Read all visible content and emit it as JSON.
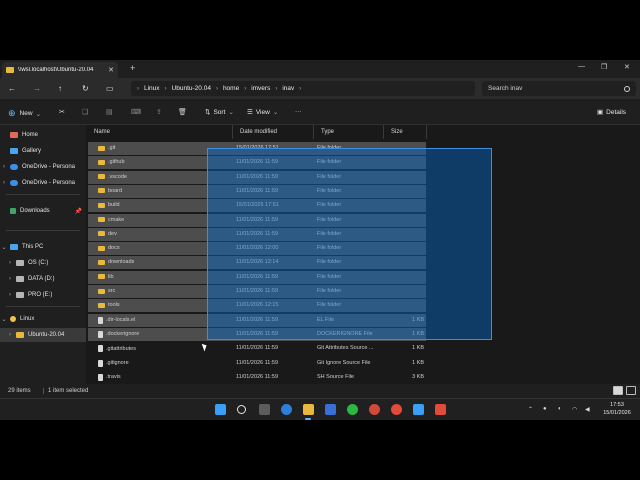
{
  "window": {
    "tab_title": "\\\\wsl.localhost\\Ubuntu-20.04",
    "tab_close": "✕",
    "tab_add": "+"
  },
  "address": {
    "crumbs": [
      "Linux",
      "Ubuntu-20.04",
      "home",
      "imvers",
      "inav"
    ],
    "search_placeholder": "Search inav"
  },
  "toolbar": {
    "new_label": "New",
    "sort_label": "Sort",
    "view_label": "View",
    "more_label": "···",
    "details_label": "Details"
  },
  "sidebar": {
    "items": [
      {
        "label": "Home",
        "color": "#e36a5a"
      },
      {
        "label": "Gallery",
        "color": "#4aa3f0"
      },
      {
        "label": "OneDrive - Persona",
        "color": "#3b8fe8"
      },
      {
        "label": "OneDrive - Persona",
        "color": "#3b8fe8"
      },
      {
        "label": "Downloads",
        "color": "#3fa36a"
      },
      {
        "label": "This PC",
        "color": "#4aa3f0"
      },
      {
        "label": "OS (C:)",
        "color": "#b5b5b5"
      },
      {
        "label": "DATA (D:)",
        "color": "#b5b5b5"
      },
      {
        "label": "PRO (E:)",
        "color": "#b5b5b5"
      },
      {
        "label": "Linux",
        "color": "#f0c24a"
      },
      {
        "label": "Ubuntu-20.04",
        "color": "#e8b93d"
      }
    ]
  },
  "columns": {
    "name": "Name",
    "date": "Date modified",
    "type": "Type",
    "size": "Size"
  },
  "files": [
    {
      "name": ".git",
      "date": "15/01/2026 17:51",
      "type": "File folder",
      "size": "",
      "kind": "folder",
      "selected": true
    },
    {
      "name": ".github",
      "date": "11/01/2026 11:59",
      "type": "File folder",
      "size": "",
      "kind": "folder",
      "selected": true
    },
    {
      "name": ".vscode",
      "date": "11/01/2026 11:59",
      "type": "File folder",
      "size": "",
      "kind": "folder",
      "selected": true
    },
    {
      "name": "board",
      "date": "11/01/2026 11:59",
      "type": "File folder",
      "size": "",
      "kind": "folder",
      "selected": true
    },
    {
      "name": "build",
      "date": "15/01/2026 17:51",
      "type": "File folder",
      "size": "",
      "kind": "folder",
      "selected": true
    },
    {
      "name": "cmake",
      "date": "11/01/2026 11:59",
      "type": "File folder",
      "size": "",
      "kind": "folder",
      "selected": true
    },
    {
      "name": "dev",
      "date": "11/01/2026 11:59",
      "type": "File folder",
      "size": "",
      "kind": "folder",
      "selected": true
    },
    {
      "name": "docs",
      "date": "11/01/2026 12:00",
      "type": "File folder",
      "size": "",
      "kind": "folder",
      "selected": true
    },
    {
      "name": "downloads",
      "date": "11/01/2026 12:14",
      "type": "File folder",
      "size": "",
      "kind": "folder",
      "selected": true
    },
    {
      "name": "lib",
      "date": "11/01/2026 11:59",
      "type": "File folder",
      "size": "",
      "kind": "folder",
      "selected": true
    },
    {
      "name": "src",
      "date": "11/01/2026 11:59",
      "type": "File folder",
      "size": "",
      "kind": "folder",
      "selected": true
    },
    {
      "name": "tools",
      "date": "11/01/2026 12:15",
      "type": "File folder",
      "size": "",
      "kind": "folder",
      "selected": true
    },
    {
      "name": ".dir-locals.el",
      "date": "11/01/2026 11:59",
      "type": "EL File",
      "size": "1 KB",
      "kind": "file",
      "selected": true
    },
    {
      "name": ".dockerignore",
      "date": "11/01/2026 11:59",
      "type": "DOCKERIGNORE File",
      "size": "1 KB",
      "kind": "file",
      "selected": true
    },
    {
      "name": ".gitattributes",
      "date": "11/01/2026 11:59",
      "type": "Git Attributes Source ...",
      "size": "1 KB",
      "kind": "file",
      "selected": false
    },
    {
      "name": ".gitignore",
      "date": "11/01/2026 11:59",
      "type": "Git Ignore Source File",
      "size": "1 KB",
      "kind": "file",
      "selected": false
    },
    {
      "name": ".travis",
      "date": "11/01/2026 11:59",
      "type": "SH Source File",
      "size": "3 KB",
      "kind": "file",
      "selected": false
    }
  ],
  "status": {
    "count": "29 items",
    "selected": "1 item selected"
  },
  "clock": {
    "time": "17:53",
    "date": "15/01/2026"
  }
}
